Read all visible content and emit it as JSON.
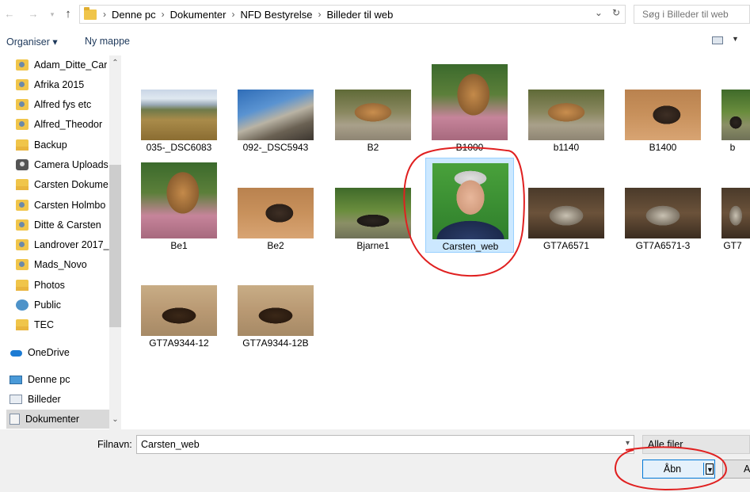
{
  "address": {
    "breadcrumbs": [
      "Denne pc",
      "Dokumenter",
      "NFD Bestyrelse",
      "Billeder til web"
    ],
    "search_placeholder": "Søg i Billeder til web"
  },
  "toolbar": {
    "organize_label": "Organiser ▾",
    "new_folder_label": "Ny mappe"
  },
  "sidebar": {
    "items": [
      {
        "label": "Adam_Ditte_Car",
        "icon": "person-folder-icon"
      },
      {
        "label": "Afrika 2015",
        "icon": "person-folder-icon"
      },
      {
        "label": "Alfred fys etc",
        "icon": "person-folder-icon"
      },
      {
        "label": "Alfred_Theodor",
        "icon": "person-folder-icon"
      },
      {
        "label": "Backup",
        "icon": "folder-icon"
      },
      {
        "label": "Camera Uploads",
        "icon": "camera-icon"
      },
      {
        "label": "Carsten Dokume",
        "icon": "folder-icon"
      },
      {
        "label": "Carsten Holmbo",
        "icon": "person-folder-icon"
      },
      {
        "label": "Ditte & Carsten",
        "icon": "person-folder-icon"
      },
      {
        "label": "Landrover 2017_",
        "icon": "person-folder-icon"
      },
      {
        "label": "Mads_Novo",
        "icon": "person-folder-icon"
      },
      {
        "label": "Photos",
        "icon": "folder-icon"
      },
      {
        "label": "Public",
        "icon": "globe-icon"
      },
      {
        "label": "TEC",
        "icon": "folder-icon"
      },
      {
        "label": "OneDrive",
        "icon": "onedrive-icon"
      },
      {
        "label": "Denne pc",
        "icon": "pc-icon"
      },
      {
        "label": "Billeder",
        "icon": "pictures-icon"
      },
      {
        "label": "Dokumenter",
        "icon": "documents-icon"
      }
    ]
  },
  "files": [
    {
      "name": "035-_DSC6083",
      "style": "ph-landscape1"
    },
    {
      "name": "092-_DSC5943",
      "style": "ph-mountain"
    },
    {
      "name": "B2",
      "style": "ph-jaguar"
    },
    {
      "name": "B1000",
      "style": "ph-jaguar-pink"
    },
    {
      "name": "b1140",
      "style": "ph-jaguar"
    },
    {
      "name": "B1400",
      "style": "ph-otter"
    },
    {
      "name": "b",
      "style": "ph-otter-grass"
    },
    {
      "name": "Be1",
      "style": "ph-jaguar-pink"
    },
    {
      "name": "Be2",
      "style": "ph-otter"
    },
    {
      "name": "Bjarne1",
      "style": "ph-otter-grass"
    },
    {
      "name": "Carsten_web",
      "style": "ph-portrait"
    },
    {
      "name": "GT7A6571",
      "style": "ph-anteater"
    },
    {
      "name": "GT7A6571-3",
      "style": "ph-anteater"
    },
    {
      "name": "GT7",
      "style": "ph-anteater"
    },
    {
      "name": "GT7A9344-12",
      "style": "ph-beaver"
    },
    {
      "name": "GT7A9344-12B",
      "style": "ph-beaver"
    }
  ],
  "selected_file": "Carsten_web",
  "bottom": {
    "filename_label": "Filnavn:",
    "filename_value": "Carsten_web",
    "filter_label": "Alle filer",
    "open_label": "Åbn",
    "cancel_label": "A"
  },
  "colors": {
    "annotation": "#e02020",
    "selection": "#cce8ff",
    "accent": "#0078d7"
  }
}
